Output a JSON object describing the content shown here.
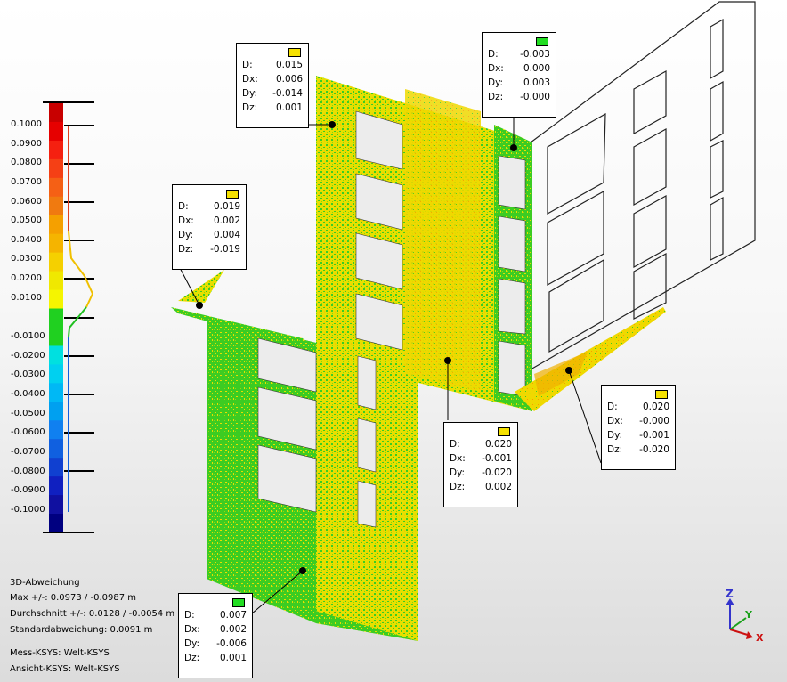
{
  "color_scale": {
    "labels": [
      "0.1000",
      "0.0900",
      "0.0800",
      "0.0700",
      "0.0600",
      "0.0500",
      "0.0400",
      "0.0300",
      "0.0200",
      "0.0100",
      "-0.0100",
      "-0.0200",
      "-0.0300",
      "-0.0400",
      "-0.0500",
      "-0.0600",
      "-0.0700",
      "-0.0800",
      "-0.0900",
      "-0.1000"
    ],
    "colors_top_to_bottom": [
      "#c80000",
      "#e60000",
      "#f52010",
      "#f54015",
      "#f56015",
      "#f07a10",
      "#f5a000",
      "#f5b400",
      "#f5d000",
      "#f0e800",
      "#f5f500",
      "#20d020",
      "#20d020",
      "#00e0e0",
      "#00d0f0",
      "#00b8f5",
      "#00a0f0",
      "#1080f0",
      "#1060e0",
      "#1040d0",
      "#1020c0",
      "#1010a0",
      "#000080"
    ]
  },
  "callouts": [
    {
      "id": "c1",
      "swatch": "#f5e100",
      "D": "0.015",
      "Dx": "0.006",
      "Dy": "-0.014",
      "Dz": "0.001"
    },
    {
      "id": "c2",
      "swatch": "#22dd22",
      "D": "-0.003",
      "Dx": "0.000",
      "Dy": "0.003",
      "Dz": "-0.000"
    },
    {
      "id": "c3",
      "swatch": "#f5e100",
      "D": "0.019",
      "Dx": "0.002",
      "Dy": "0.004",
      "Dz": "-0.019"
    },
    {
      "id": "c4",
      "swatch": "#f5e100",
      "D": "0.020",
      "Dx": "-0.001",
      "Dy": "-0.020",
      "Dz": "0.002"
    },
    {
      "id": "c5",
      "swatch": "#f5e100",
      "D": "0.020",
      "Dx": "-0.000",
      "Dy": "-0.001",
      "Dz": "-0.020"
    },
    {
      "id": "c6",
      "swatch": "#22dd22",
      "D": "0.007",
      "Dx": "0.002",
      "Dy": "-0.006",
      "Dz": "0.001"
    }
  ],
  "callout_keys": {
    "D": "D:",
    "Dx": "Dx:",
    "Dy": "Dy:",
    "Dz": "Dz:"
  },
  "stats": {
    "title": "3D-Abweichung",
    "max": "Max +/-: 0.0973 / -0.0987 m",
    "mean": "Durchschnitt +/-: 0.0128 / -0.0054 m",
    "std": "Standardabweichung: 0.0091 m",
    "mess": "Mess-KSYS: Welt-KSYS",
    "ansicht": "Ansicht-KSYS: Welt-KSYS"
  },
  "axes": {
    "z": "Z",
    "y": "Y",
    "x": "X"
  },
  "colors": {
    "yellow": "#f0e000",
    "green": "#22cc22",
    "axis_z": "#3333cc",
    "axis_y": "#1aa01a",
    "axis_x": "#cc1111"
  }
}
